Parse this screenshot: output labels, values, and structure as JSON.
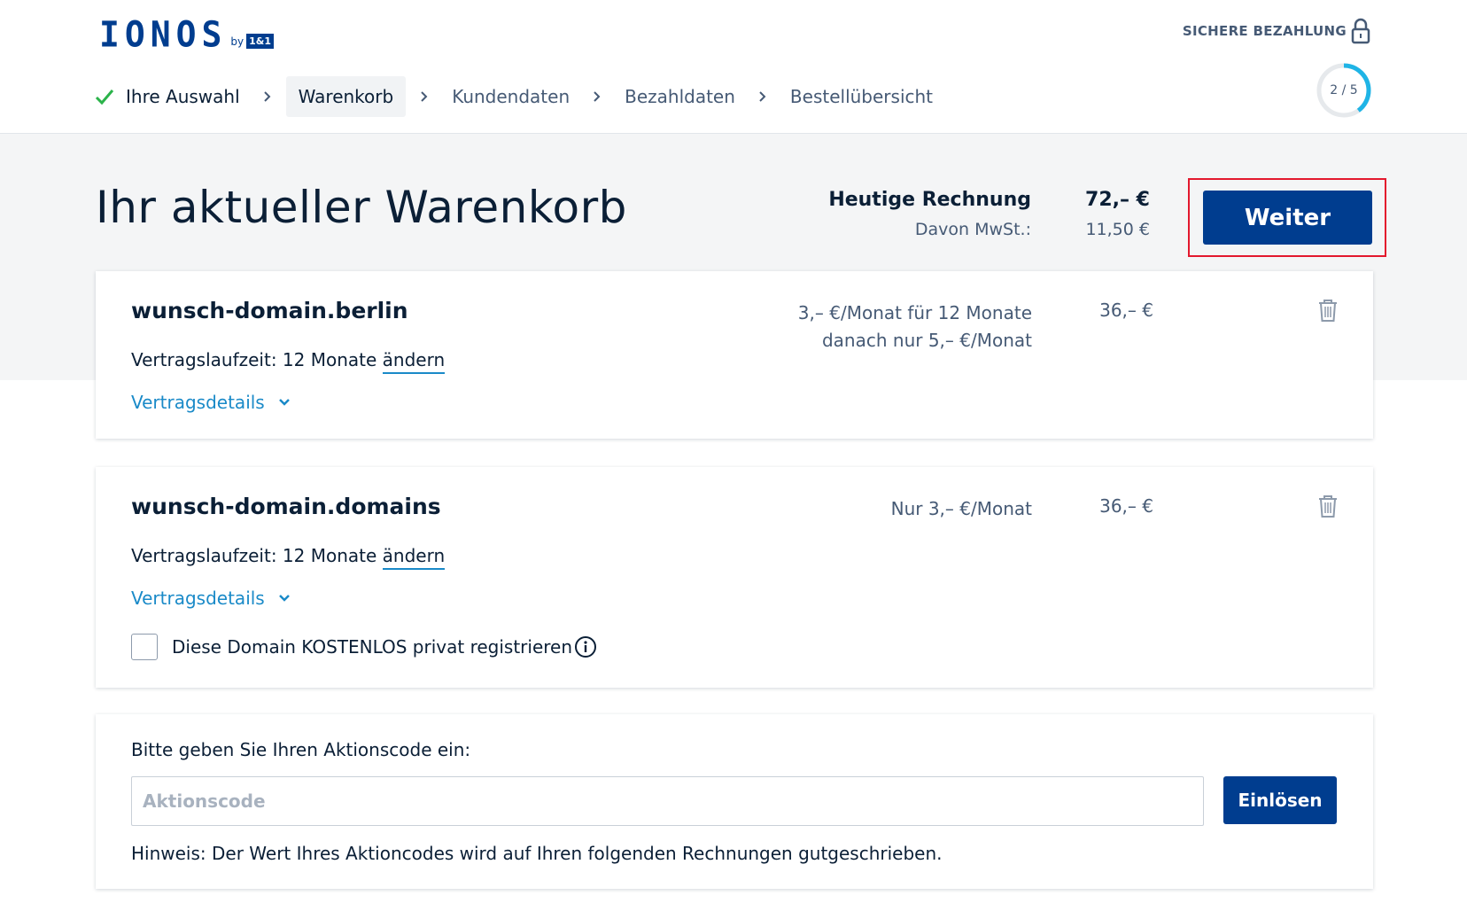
{
  "header": {
    "logo": {
      "text": "IONOS",
      "by": "by",
      "badge": "1&1"
    },
    "secure_payment": "SICHERE BEZAHLUNG",
    "progress": {
      "label": "2 / 5",
      "current": 2,
      "total": 5
    },
    "steps": [
      {
        "label": "Ihre Auswahl",
        "state": "done"
      },
      {
        "label": "Warenkorb",
        "state": "active"
      },
      {
        "label": "Kundendaten",
        "state": "upcoming"
      },
      {
        "label": "Bezahldaten",
        "state": "upcoming"
      },
      {
        "label": "Bestellübersicht",
        "state": "upcoming"
      }
    ]
  },
  "summary": {
    "title": "Ihr aktueller Warenkorb",
    "invoice_label": "Heutige Rechnung",
    "invoice_value": "72,– €",
    "vat_label": "Davon MwSt.:",
    "vat_value": "11,50 €",
    "continue_label": "Weiter"
  },
  "cart_items": [
    {
      "domain": "wunsch-domain.berlin",
      "term_label": "Vertragslaufzeit: 12 Monate",
      "change_label": "ändern",
      "details_label": "Vertragsdetails",
      "price_line1": "3,– €/Monat für 12 Monate",
      "price_line2": "danach nur 5,– €/Monat",
      "price": "36,– €"
    },
    {
      "domain": "wunsch-domain.domains",
      "term_label": "Vertragslaufzeit: 12 Monate",
      "change_label": "ändern",
      "details_label": "Vertragsdetails",
      "price_line1": "Nur 3,– €/Monat",
      "price": "36,– €",
      "privacy_checkbox_label": "Diese Domain KOSTENLOS privat registrieren"
    }
  ],
  "promo": {
    "label": "Bitte geben Sie Ihren Aktionscode ein:",
    "value": "",
    "placeholder": "Aktionscode",
    "button_label": "Einlösen",
    "hint": "Hinweis: Der Wert Ihres Aktioncodes wird auf Ihren folgenden Rechnungen gutgeschrieben."
  },
  "colors": {
    "brand": "#003d8f",
    "link": "#1a8ac8",
    "progress_accent": "#1fb4e6",
    "check": "#2bb34a",
    "highlight": "#e3182d"
  },
  "icons": [
    "check-icon",
    "chevron-right-icon",
    "lock-icon",
    "trash-icon",
    "chevron-down-icon",
    "info-icon"
  ]
}
